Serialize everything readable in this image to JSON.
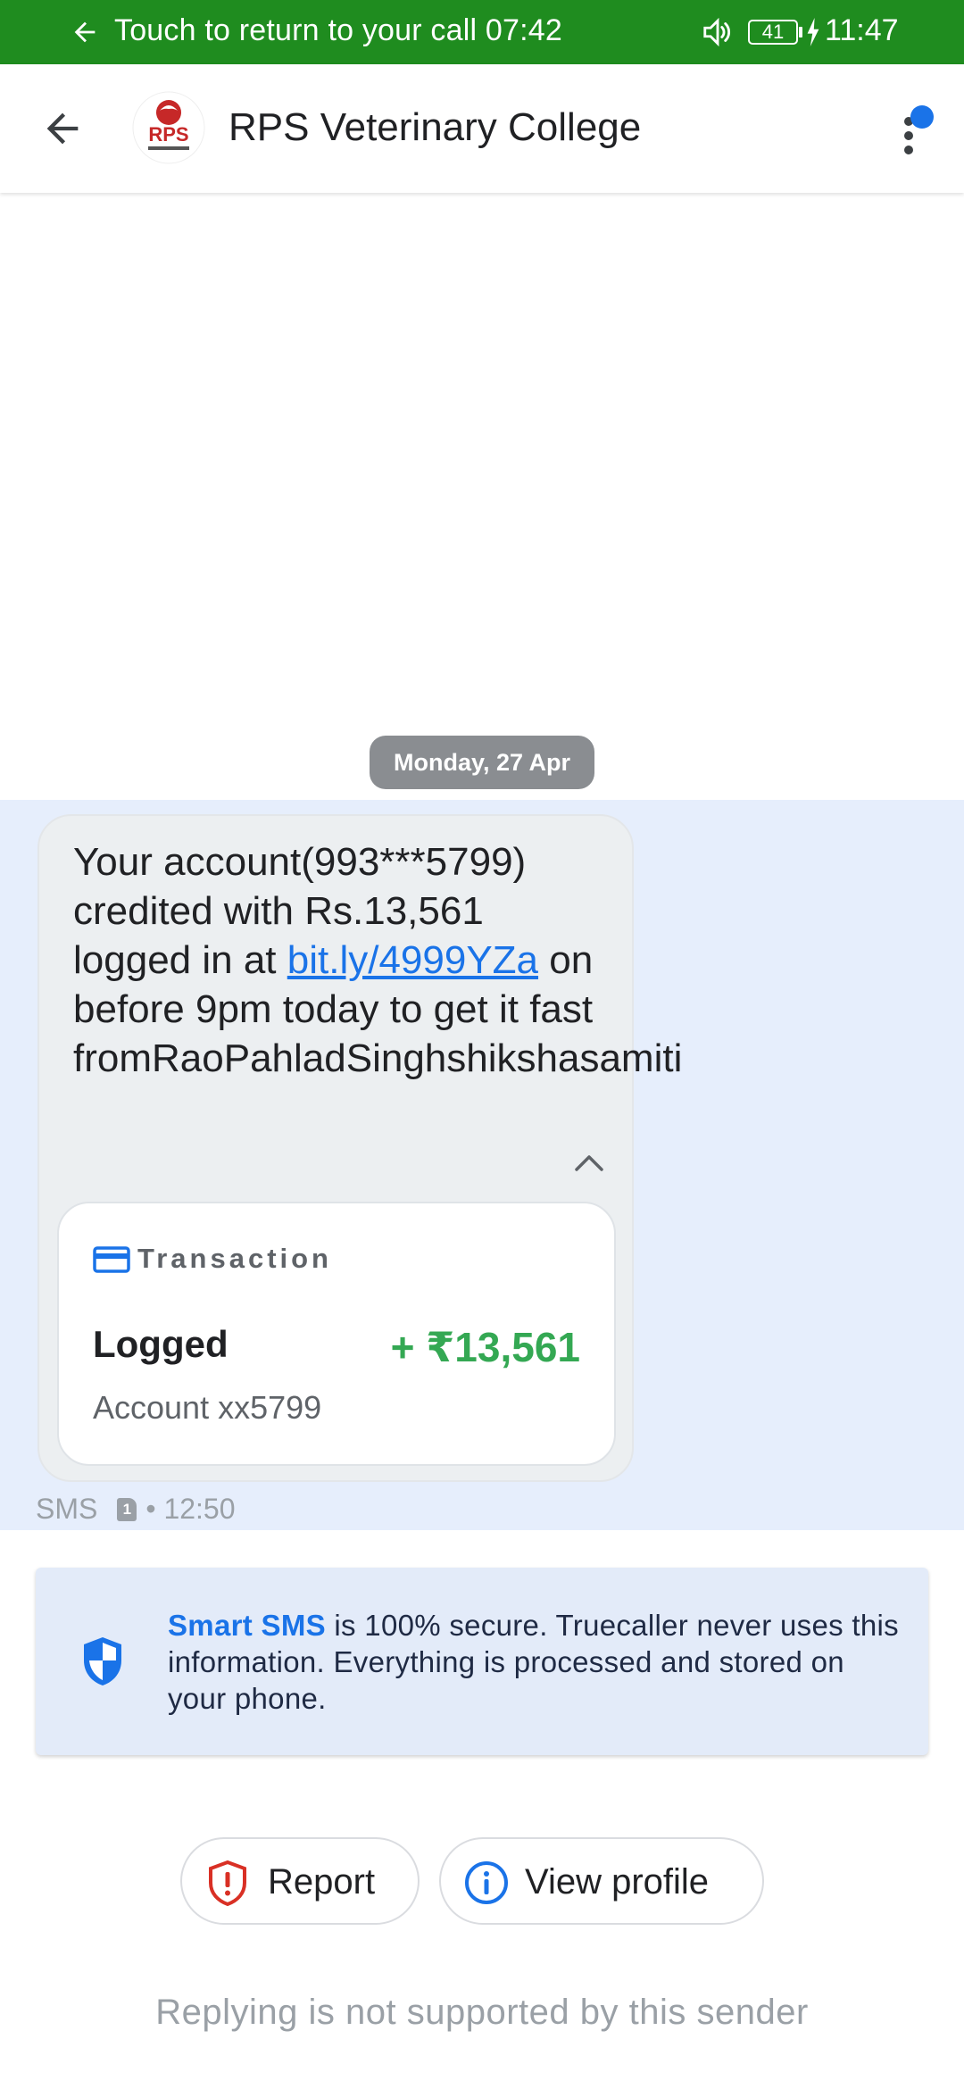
{
  "call_banner": {
    "text": "Touch to return to your call 07:42",
    "battery": "41",
    "clock": "11:47"
  },
  "header": {
    "title": "RPS Veterinary College",
    "logo_text": "RPS"
  },
  "conversation": {
    "date_chip": "Monday, 27 Apr",
    "message": {
      "text_before_link": "Your account(993***5799) credited with Rs.13,561 logged in at ",
      "link": "bit.ly/4999YZa",
      "text_after_link": " on before 9pm today to get it fast fromRaoPahladSinghshikshasamiti"
    },
    "transaction_card": {
      "title": "Transaction",
      "status": "Logged",
      "amount": "+ ₹13,561",
      "account": "Account xx5799"
    },
    "meta": {
      "type": "SMS",
      "sim": "1",
      "time": "• 12:50"
    }
  },
  "notice": {
    "highlight": "Smart SMS",
    "text": " is 100% secure. Truecaller never uses this information. Everything is processed and stored on your phone."
  },
  "actions": {
    "report_label": "Report",
    "view_profile_label": "View profile"
  },
  "footer_note": "Replying is not supported by this sender",
  "colors": {
    "call_banner": "#1f8c1f",
    "accent": "#1a73e8",
    "amount_positive": "#34a853",
    "report_red": "#d93025",
    "message_band": "#e6eefc"
  }
}
